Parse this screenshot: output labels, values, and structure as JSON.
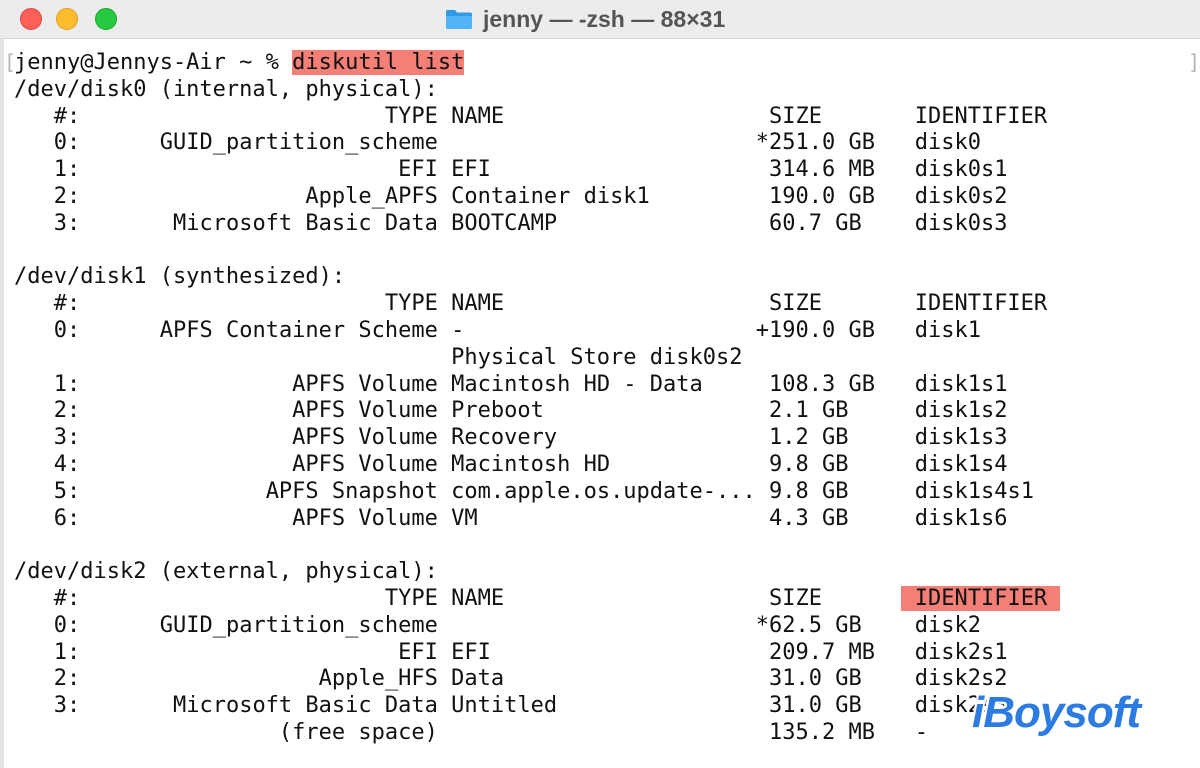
{
  "window": {
    "title": "jenny — -zsh — 88×31"
  },
  "prompt": {
    "text": "jenny@Jennys-Air ~ % ",
    "command": "diskutil list"
  },
  "disks": [
    {
      "header": "/dev/disk0 (internal, physical):",
      "col_header": {
        "num": "#:",
        "type": "TYPE",
        "name": "NAME",
        "size": "SIZE",
        "identifier": "IDENTIFIER"
      },
      "rows": [
        {
          "num": "0:",
          "type": "GUID_partition_scheme",
          "name": "",
          "size": "*251.0 GB",
          "identifier": "disk0"
        },
        {
          "num": "1:",
          "type": "EFI",
          "name": "EFI",
          "size": "314.6 MB",
          "identifier": "disk0s1"
        },
        {
          "num": "2:",
          "type": "Apple_APFS",
          "name": "Container disk1",
          "size": "190.0 GB",
          "identifier": "disk0s2"
        },
        {
          "num": "3:",
          "type": "Microsoft Basic Data",
          "name": "BOOTCAMP",
          "size": "60.7 GB",
          "identifier": "disk0s3"
        }
      ]
    },
    {
      "header": "/dev/disk1 (synthesized):",
      "col_header": {
        "num": "#:",
        "type": "TYPE",
        "name": "NAME",
        "size": "SIZE",
        "identifier": "IDENTIFIER"
      },
      "rows": [
        {
          "num": "0:",
          "type": "APFS Container Scheme",
          "name": "-",
          "size": "+190.0 GB",
          "identifier": "disk1"
        },
        {
          "num": "",
          "type": "",
          "name": "Physical Store disk0s2",
          "size": "",
          "identifier": ""
        },
        {
          "num": "1:",
          "type": "APFS Volume",
          "name": "Macintosh HD - Data",
          "size": "108.3 GB",
          "identifier": "disk1s1"
        },
        {
          "num": "2:",
          "type": "APFS Volume",
          "name": "Preboot",
          "size": "2.1 GB",
          "identifier": "disk1s2"
        },
        {
          "num": "3:",
          "type": "APFS Volume",
          "name": "Recovery",
          "size": "1.2 GB",
          "identifier": "disk1s3"
        },
        {
          "num": "4:",
          "type": "APFS Volume",
          "name": "Macintosh HD",
          "size": "9.8 GB",
          "identifier": "disk1s4"
        },
        {
          "num": "5:",
          "type": "APFS Snapshot",
          "name": "com.apple.os.update-...",
          "size": "9.8 GB",
          "identifier": "disk1s4s1"
        },
        {
          "num": "6:",
          "type": "APFS Volume",
          "name": "VM",
          "size": "4.3 GB",
          "identifier": "disk1s6"
        }
      ]
    },
    {
      "header": "/dev/disk2 (external, physical):",
      "col_header": {
        "num": "#:",
        "type": "TYPE",
        "name": "NAME",
        "size": "SIZE",
        "identifier": "IDENTIFIER"
      },
      "rows": [
        {
          "num": "0:",
          "type": "GUID_partition_scheme",
          "name": "",
          "size": "*62.5 GB",
          "identifier": "disk2"
        },
        {
          "num": "1:",
          "type": "EFI",
          "name": "EFI",
          "size": "209.7 MB",
          "identifier": "disk2s1"
        },
        {
          "num": "2:",
          "type": "Apple_HFS",
          "name": "Data",
          "size": "31.0 GB",
          "identifier": "disk2s2"
        },
        {
          "num": "3:",
          "type": "Microsoft Basic Data",
          "name": "Untitled",
          "size": "31.0 GB",
          "identifier": "disk2s3"
        },
        {
          "num": "",
          "type": "(free space)",
          "name": "",
          "size": "135.2 MB",
          "identifier": "-"
        }
      ]
    }
  ],
  "watermark": "iBoysoft",
  "colors": {
    "highlight": "#f47f76",
    "titlebar": "#ececec",
    "text": "#111111",
    "watermark": "#2c7be0"
  }
}
